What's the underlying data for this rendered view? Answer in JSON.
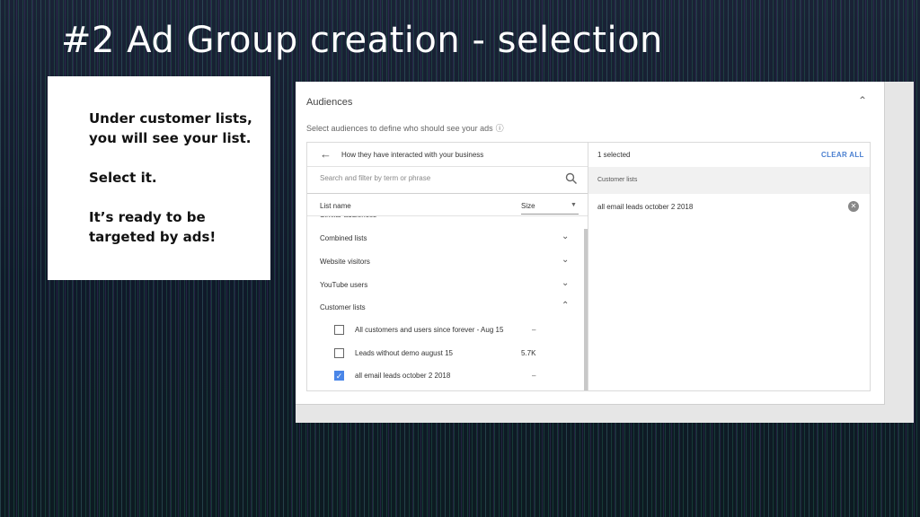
{
  "slide": {
    "title": "#2 Ad Group creation - selection",
    "notes": [
      "Under customer lists, you will see your list.",
      "Select it.",
      "It’s ready to be targeted by ads!"
    ]
  },
  "panel": {
    "title": "Audiences",
    "subtitle": "Select audiences to define who should see your ads",
    "icons": {
      "collapse": "chevron-up-icon",
      "help": "help-circle-icon"
    }
  },
  "browse": {
    "nav_label": "How they have interacted with your business",
    "search_placeholder": "Search and filter by term or phrase",
    "columns": {
      "name": "List name",
      "size": "Size"
    },
    "categories": [
      {
        "label": "Similar audiences",
        "expanded": false
      },
      {
        "label": "Combined lists",
        "expanded": false
      },
      {
        "label": "Website visitors",
        "expanded": false
      },
      {
        "label": "YouTube users",
        "expanded": false
      },
      {
        "label": "Customer lists",
        "expanded": true
      }
    ],
    "customer_list_items": [
      {
        "label": "All customers and users since forever - Aug 15",
        "size": "–",
        "checked": false
      },
      {
        "label": "Leads without demo august 15",
        "size": "5.7K",
        "checked": false
      },
      {
        "label": "all email leads october 2 2018",
        "size": "–",
        "checked": true
      }
    ]
  },
  "selection": {
    "count_label": "1 selected",
    "clear_label": "CLEAR ALL",
    "section": "Customer lists",
    "items": [
      "all email leads october 2 2018"
    ]
  },
  "colors": {
    "accent": "#4a86e8",
    "link": "#4a7fd0"
  }
}
